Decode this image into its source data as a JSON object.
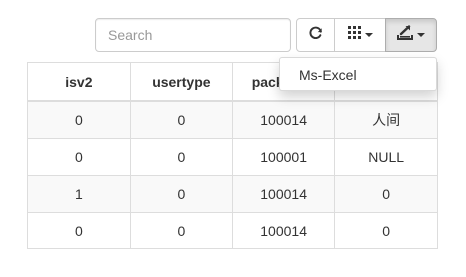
{
  "toolbar": {
    "search": {
      "placeholder": "Search",
      "value": ""
    },
    "buttons": [
      {
        "name": "refresh-button",
        "icon": "refresh-icon"
      },
      {
        "name": "columns-button",
        "icon": "grid-icon"
      },
      {
        "name": "export-button",
        "icon": "export-icon",
        "active": true
      }
    ]
  },
  "export_menu": {
    "items": [
      {
        "label": "Ms-Excel"
      }
    ]
  },
  "table": {
    "columns": [
      "isv2",
      "usertype",
      "package_",
      ""
    ],
    "rows": [
      [
        "0",
        "0",
        "100014",
        "人间"
      ],
      [
        "0",
        "0",
        "100001",
        "NULL"
      ],
      [
        "1",
        "0",
        "100014",
        "0"
      ],
      [
        "0",
        "0",
        "100014",
        "0"
      ]
    ]
  },
  "colors": {
    "border": "#dddddd",
    "stripe": "#f9f9f9",
    "active_button": "#e6e6e6"
  }
}
